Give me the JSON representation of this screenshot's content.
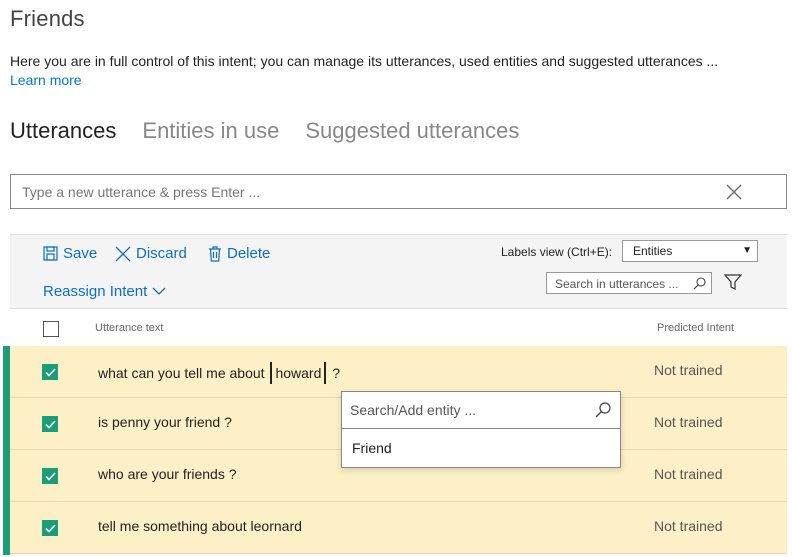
{
  "page": {
    "title": "Friends",
    "description": "Here you are in full control of this intent; you can manage its utterances, used entities and suggested utterances ...",
    "learn_more": "Learn more"
  },
  "tabs": [
    {
      "label": "Utterances",
      "active": true
    },
    {
      "label": "Entities in use",
      "active": false
    },
    {
      "label": "Suggested utterances",
      "active": false
    }
  ],
  "utterance_input": {
    "placeholder": "Type a new utterance & press Enter ...",
    "value": ""
  },
  "toolbar": {
    "save_label": "Save",
    "discard_label": "Discard",
    "delete_label": "Delete",
    "reassign_label": "Reassign Intent",
    "labels_view_label": "Labels view (Ctrl+E):",
    "labels_view_value": "Entities",
    "search_placeholder": "Search in utterances ..."
  },
  "table": {
    "col_utterance": "Utterance text",
    "col_predicted": "Predicted Intent",
    "rows": [
      {
        "pre": "what can you tell me about ",
        "entity": "howard",
        "post": " ?",
        "predicted": "Not trained",
        "checked": true
      },
      {
        "pre": "is penny your friend ?",
        "entity": "",
        "post": "",
        "predicted": "Not trained",
        "checked": true
      },
      {
        "pre": "who are your friends ?",
        "entity": "",
        "post": "",
        "predicted": "Not trained",
        "checked": true
      },
      {
        "pre": "tell me something about leornard",
        "entity": "",
        "post": "",
        "predicted": "Not trained",
        "checked": true
      }
    ]
  },
  "entity_popup": {
    "placeholder": "Search/Add entity ...",
    "items": [
      "Friend"
    ]
  },
  "colors": {
    "accent": "#1a9e7a",
    "link": "#0b6fc6",
    "row_highlight": "#fdefc6"
  }
}
